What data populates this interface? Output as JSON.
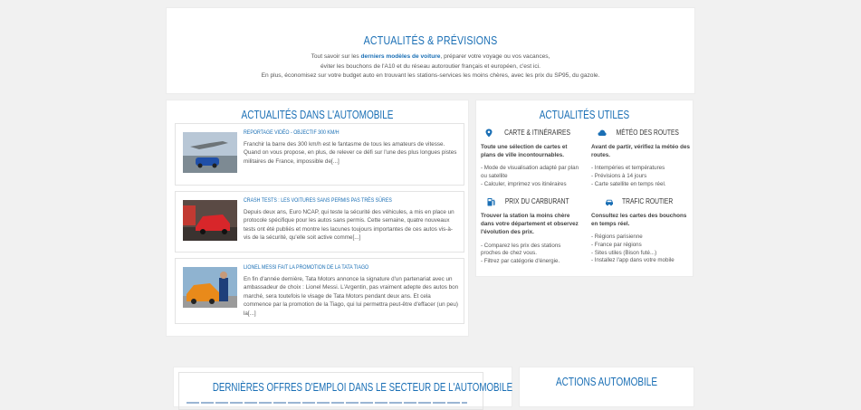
{
  "intro": {
    "title": "Actualités & Prévisions",
    "line1_pre": "Tout savoir sur les ",
    "line1_link": "derniers modèles de voiture",
    "line1_post": ", préparer votre voyage ou vos vacances,",
    "line2": "éviter les bouchons de l'A10 et du réseau autoroutier français et européen, c'est ici.",
    "line3": "En plus, économisez sur votre budget auto en trouvant les stations-services les moins chères, avec les prix du SP95, du gazole."
  },
  "news": {
    "title": "Actualités dans l'automobile",
    "articles": [
      {
        "title": "Reportage vidéo - Objectif 300 km/h",
        "body": "Franchir la barre des 300 km/h est le fantasme de tous les amateurs de vitesse. Quand on vous propose, en plus, de relever ce défi sur l'une des plus longues pistes militaires de France, impossible de[...]"
      },
      {
        "title": "Crash tests : les voitures sans permis pas très sûres",
        "body": "Depuis deux ans, Euro NCAP, qui teste la sécurité des véhicules, a mis en place un protocole spécifique pour les autos sans permis. Cette semaine, quatre nouveaux tests ont été publiés et montre les lacunes toujours importantes de ces autos vis-à-vis de la sécurité, qu'elle soit active comme[...]"
      },
      {
        "title": "Lionel Messi fait la promotion de la Tata Tiago",
        "body": "En fin d'année dernière, Tata Motors annonce la signature d'un partenariat avec un ambassadeur de choix : Lionel Messi. L'Argentin, pas vraiment adepte des autos bon marché, sera toutefois le visage de Tata Motors pendant deux ans. Et cela commence par la promotion de la Tiago, qui lui permettra peut-être d'effacer (un peu) la[...]"
      }
    ]
  },
  "useful": {
    "title": "Actualités utiles",
    "sections": [
      {
        "icon": "map-pin-icon",
        "title": "Carte & itinéraires",
        "lead": "Toute une sélection de cartes et plans de ville incontournables.",
        "items": [
          "- Mode de visualisation adapté par plan ou satellite",
          "- Calculer, imprimez vos itinéraires"
        ]
      },
      {
        "icon": "cloud-icon",
        "title": "Météo des routes",
        "lead": "Avant de partir, vérifiez la météo des routes.",
        "items": [
          "- Intempéries et températures",
          "- Prévisions à 14 jours",
          "- Carte satellite en temps réel."
        ]
      },
      {
        "icon": "fuel-pump-icon",
        "title": "Prix du carburant",
        "lead": "Trouver la station la moins chère dans votre département et observez l'évolution des prix.",
        "items": [
          "- Comparez les prix des stations proches de chez vous.",
          "- Filtrez par catégorie d'énergie."
        ]
      },
      {
        "icon": "car-icon",
        "title": "Trafic routier",
        "lead": "Consultez les cartes des bouchons en temps réel.",
        "items": [
          "- Régions parisienne",
          "- France par régions",
          "- Sites utiles (Bison futé...)",
          "- Installez l'app dans votre mobile"
        ]
      }
    ]
  },
  "jobs": {
    "title": "Dernières offres d'emploi dans le secteur de l'automobile"
  },
  "actions": {
    "title": "Actions automobile"
  },
  "colors": {
    "accent": "#1a6fb5",
    "background": "#f1f1f1"
  }
}
